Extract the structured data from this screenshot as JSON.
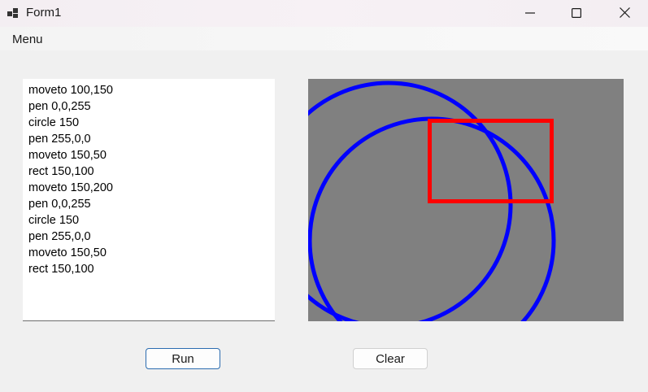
{
  "window": {
    "title": "Form1"
  },
  "title_controls": [
    {
      "name": "minimize-button",
      "icon": "minimize-icon"
    },
    {
      "name": "maximize-button",
      "icon": "maximize-icon"
    },
    {
      "name": "close-button",
      "icon": "close-icon"
    }
  ],
  "menu": {
    "items": [
      {
        "label": "Menu"
      }
    ]
  },
  "editor": {
    "lines": [
      "moveto 100,150",
      "pen 0,0,255",
      "circle 150",
      "pen 255,0,0",
      "moveto 150,50",
      "rect 150,100",
      "moveto 150,200",
      "pen 0,0,255",
      "circle 150",
      "pen 255,0,0",
      "moveto 150,50",
      "rect 150,100"
    ]
  },
  "canvas": {
    "background": "#808080",
    "shapes": [
      {
        "type": "circle",
        "color": "#0000ff"
      },
      {
        "type": "circle",
        "color": "#0000ff"
      },
      {
        "type": "rect",
        "color": "#ff0000"
      }
    ]
  },
  "buttons": {
    "run": "Run",
    "clear": "Clear"
  },
  "colors": {
    "run_border": "#2b6cb0"
  }
}
